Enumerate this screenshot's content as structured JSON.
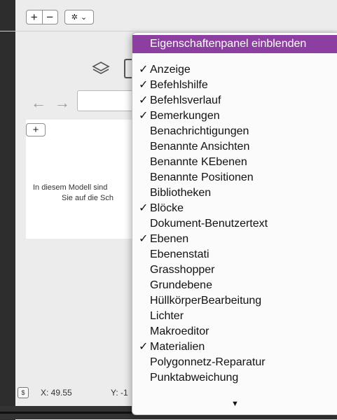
{
  "toolbar": {
    "plus_glyph": "+",
    "minus_glyph": "−",
    "gear_glyph": "✲",
    "gear_caret": "⌄"
  },
  "panel": {
    "back_glyph": "←",
    "forward_glyph": "→",
    "add_glyph": "+",
    "message_line1": "In diesem Modell sind",
    "message_line2": "Sie auf die Sch"
  },
  "status": {
    "unit_glyph": "$",
    "x_label": "X: 49.55",
    "y_label": "Y: -1"
  },
  "menu": {
    "highlighted": "Eigenschaftenpanel einblenden",
    "check_glyph": "✓",
    "more_glyph": "▼",
    "items": [
      {
        "label": "Anzeige",
        "checked": true
      },
      {
        "label": "Befehlshilfe",
        "checked": true
      },
      {
        "label": "Befehlsverlauf",
        "checked": true
      },
      {
        "label": "Bemerkungen",
        "checked": true
      },
      {
        "label": "Benachrichtigungen",
        "checked": false
      },
      {
        "label": "Benannte Ansichten",
        "checked": false
      },
      {
        "label": "Benannte KEbenen",
        "checked": false
      },
      {
        "label": "Benannte Positionen",
        "checked": false
      },
      {
        "label": "Bibliotheken",
        "checked": false
      },
      {
        "label": "Blöcke",
        "checked": true
      },
      {
        "label": "Dokument-Benutzertext",
        "checked": false
      },
      {
        "label": "Ebenen",
        "checked": true
      },
      {
        "label": "Ebenenstati",
        "checked": false
      },
      {
        "label": "Grasshopper",
        "checked": false
      },
      {
        "label": "Grundebene",
        "checked": false
      },
      {
        "label": "HüllkörperBearbeitung",
        "checked": false
      },
      {
        "label": "Lichter",
        "checked": false
      },
      {
        "label": "Makroeditor",
        "checked": false
      },
      {
        "label": "Materialien",
        "checked": true
      },
      {
        "label": "Polygonnetz-Reparatur",
        "checked": false
      },
      {
        "label": "Punktabweichung",
        "checked": false
      }
    ]
  }
}
